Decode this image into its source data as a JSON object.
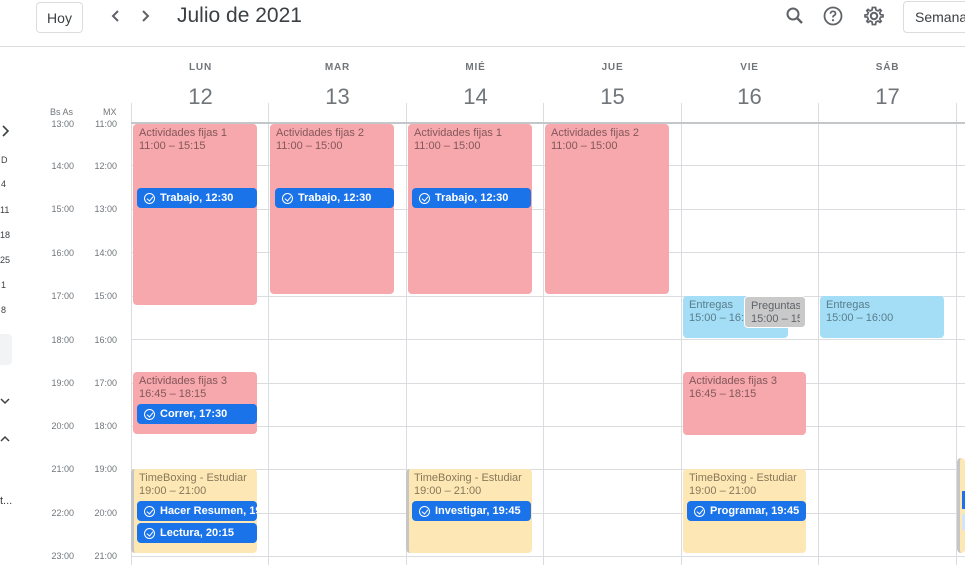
{
  "header": {
    "today_button": "Hoy",
    "title": "Julio de 2021",
    "view_button": "Semana",
    "icons": [
      "chevron-left-icon",
      "chevron-right-icon",
      "search-icon",
      "help-icon",
      "settings-icon"
    ]
  },
  "timezones": {
    "primary": "Bs As",
    "secondary": "MX"
  },
  "days": [
    {
      "name": "LUN",
      "number": "12"
    },
    {
      "name": "MAR",
      "number": "13"
    },
    {
      "name": "MIÉ",
      "number": "14"
    },
    {
      "name": "JUE",
      "number": "15"
    },
    {
      "name": "VIE",
      "number": "16"
    },
    {
      "name": "SÁB",
      "number": "17"
    }
  ],
  "times_primary": [
    "13:00",
    "14:00",
    "15:00",
    "16:00",
    "17:00",
    "18:00",
    "19:00",
    "20:00",
    "21:00",
    "22:00",
    "23:00"
  ],
  "times_secondary": [
    "11:00",
    "12:00",
    "13:00",
    "14:00",
    "15:00",
    "16:00",
    "17:00",
    "18:00",
    "19:00",
    "20:00",
    "21:00"
  ],
  "left_sidebar": {
    "letters": [
      "D",
      "4",
      "11",
      "18",
      "25",
      "1",
      "8"
    ],
    "truncated": "t..."
  },
  "events": {
    "lun_fijas1": {
      "title": "Actividades fijas 1",
      "time": "11:00 – 15:15"
    },
    "mar_fijas2": {
      "title": "Actividades fijas 2",
      "time": "11:00 – 15:00"
    },
    "mie_fijas1": {
      "title": "Actividades fijas 1",
      "time": "11:00 – 15:00"
    },
    "jue_fijas2": {
      "title": "Actividades fijas 2",
      "time": "11:00 – 15:00"
    },
    "lun_fijas3": {
      "title": "Actividades fijas 3",
      "time": "16:45 – 18:15"
    },
    "vie_fijas3": {
      "title": "Actividades fijas 3",
      "time": "16:45 – 18:15"
    },
    "vie_entregas": {
      "title": "Entregas",
      "time": "15:00 – 16:"
    },
    "vie_preguntas": {
      "title": "Preguntas p",
      "time": "15:00 – 15:"
    },
    "sab_entregas": {
      "title": "Entregas",
      "time": "15:00 – 16:00"
    },
    "lun_timeboxing": {
      "title": "TimeBoxing - Estudiar",
      "time": "19:00 – 21:00"
    },
    "mie_timeboxing": {
      "title": "TimeBoxing - Estudiar",
      "time": "19:00 – 21:00"
    },
    "vie_timeboxing": {
      "title": "TimeBoxing - Estudiar",
      "time": "19:00 – 21:00"
    }
  },
  "tasks": {
    "lun_trabajo": "Trabajo, 12:30",
    "mar_trabajo": "Trabajo, 12:30",
    "mie_trabajo": "Trabajo, 12:30",
    "lun_correr": "Correr, 17:30",
    "lun_resumen": "Hacer Resumen, 19",
    "lun_lectura": "Lectura, 20:15",
    "mie_investigar": "Investigar, 19:45",
    "vie_programar": "Programar, 19:45"
  },
  "colors": {
    "pink": "#f6a8ac",
    "yellow": "#fde7b4",
    "light_blue": "#a3def6",
    "task_blue": "#1a73e8",
    "gray": "#c9c9c9"
  }
}
